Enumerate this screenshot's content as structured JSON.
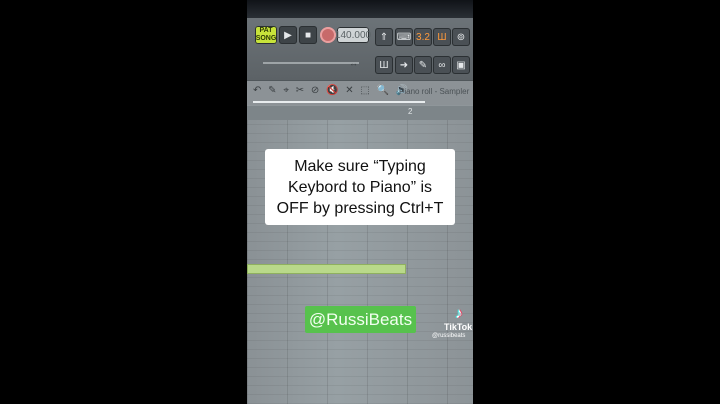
{
  "toolbar": {
    "song_toggle_top": "PAT",
    "song_toggle_bottom": "SONG",
    "play_glyph": "▶",
    "stop_glyph": "■",
    "tempo": "140.000",
    "icons": [
      "snap-icon",
      "keyboard-icon",
      "metronome-icon",
      "wait-icon",
      "step-icon",
      "piano-icon",
      "arrow-icon",
      "link-icon",
      "wrench-icon"
    ],
    "slider_glyph": "↔"
  },
  "piano_roll": {
    "tool_icons": "↶ ✎ ⌖ ✂ ⊘ 🔇 ✕ ⬚ 🔍 🔊",
    "title": "Piano roll - Sampler",
    "bar_number": "2"
  },
  "overlay": {
    "caption": "Make sure “Typing Keybord to Piano” is OFF by pressing Ctrl+T",
    "handle": "@RussiBeats",
    "tiktok_word": "TikTok",
    "tiktok_user": "@russibeats"
  },
  "colors": {
    "song_toggle": "#c7e33a",
    "handle_bg": "#57c24d",
    "note": "#b9d98a"
  }
}
